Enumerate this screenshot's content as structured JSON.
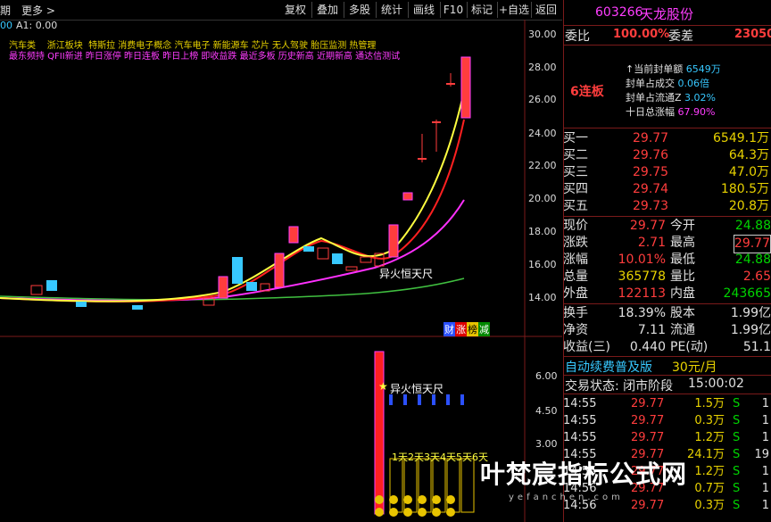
{
  "toolbar": {
    "left_cut": "期",
    "more": "更多 >",
    "buttons": [
      "复权",
      "叠加",
      "多股",
      "统计",
      "画线",
      "F10",
      "标记",
      "+自选",
      "返回"
    ]
  },
  "chart_header": {
    "indicator": "A1: 0.00",
    "concepts_line1": [
      "汽车类",
      "浙江板块",
      "特斯拉",
      "消费电子概念",
      "汽车电子",
      "新能源车",
      "芯片",
      "无人驾驶",
      "胎压监测",
      "热管理"
    ],
    "concepts_line2": "最东频持 QFII新进 昨日涨停 昨日连板 昨日上榜 即收益跌 最近多板 历史新高 近期新高 通达信测试"
  },
  "price_axis": [
    "30.00",
    "28.00",
    "26.00",
    "24.00",
    "22.00",
    "20.00",
    "18.00",
    "16.00",
    "14.00"
  ],
  "annotations": {
    "main": "异火恒天尺",
    "badge1": "财",
    "badge2": "涨",
    "badge3": "榜",
    "badge4": "减",
    "sub": "异火恒天尺",
    "days": [
      "1天",
      "2天",
      "3天",
      "4天",
      "5天",
      "6天"
    ]
  },
  "sub_axis": [
    "6.00",
    "4.50",
    "3.00"
  ],
  "stock": {
    "code": "603266",
    "name": "天龙股份",
    "weibi_label": "委比",
    "weibi": "100.00%",
    "weicha_label": "委差",
    "weicha": "23050",
    "board": "6连板",
    "seal_stats": [
      {
        "label": "当前封单额",
        "value": "6549万"
      },
      {
        "label": "封单占成交",
        "value": "0.06倍"
      },
      {
        "label": "封单占流通Z",
        "value": "3.02%"
      },
      {
        "label": "十日总涨幅",
        "value": "67.90%"
      }
    ]
  },
  "bids": [
    {
      "label": "买一",
      "price": "29.77",
      "vol": "6549.1万"
    },
    {
      "label": "买二",
      "price": "29.76",
      "vol": "64.3万"
    },
    {
      "label": "买三",
      "price": "29.75",
      "vol": "47.0万"
    },
    {
      "label": "买四",
      "price": "29.74",
      "vol": "180.5万"
    },
    {
      "label": "买五",
      "price": "29.73",
      "vol": "20.8万"
    }
  ],
  "quote": [
    {
      "l1": "现价",
      "v1": "29.77",
      "l2": "今开",
      "v2": "24.88"
    },
    {
      "l1": "涨跌",
      "v1": "2.71",
      "l2": "最高",
      "v2": "29.77"
    },
    {
      "l1": "涨幅",
      "v1": "10.01%",
      "l2": "最低",
      "v2": "24.88"
    },
    {
      "l1": "总量",
      "v1": "365778",
      "l2": "量比",
      "v2": "2.65"
    },
    {
      "l1": "外盘",
      "v1": "122113",
      "l2": "内盘",
      "v2": "243665"
    }
  ],
  "fund": [
    {
      "l1": "换手",
      "v1": "18.39%",
      "l2": "股本",
      "v2": "1.99亿"
    },
    {
      "l1": "净资",
      "v1": "7.11",
      "l2": "流通",
      "v2": "1.99亿"
    },
    {
      "l1": "收益(三)",
      "v1": "0.440",
      "l2": "PE(动)",
      "v2": "51.1"
    }
  ],
  "promo": {
    "text": "自动续费普及版",
    "price": "30元/月"
  },
  "status": {
    "label": "交易状态: 闭市阶段",
    "time": "15:00:02"
  },
  "trades": [
    {
      "t": "14:55",
      "p": "29.77",
      "v": "1.5万",
      "s": "S",
      "n": "1"
    },
    {
      "t": "14:55",
      "p": "29.77",
      "v": "0.3万",
      "s": "S",
      "n": "1"
    },
    {
      "t": "14:55",
      "p": "29.77",
      "v": "1.2万",
      "s": "S",
      "n": "1"
    },
    {
      "t": "14:55",
      "p": "29.77",
      "v": "24.1万",
      "s": "S",
      "n": "19"
    },
    {
      "t": "14:55",
      "p": "29.77",
      "v": "1.2万",
      "s": "S",
      "n": "1"
    },
    {
      "t": "14:56",
      "p": "29.77",
      "v": "0.7万",
      "s": "S",
      "n": "1"
    },
    {
      "t": "14:56",
      "p": "29.77",
      "v": "0.3万",
      "s": "S",
      "n": "1"
    }
  ],
  "watermark": {
    "text": "叶梵宸指标公式网",
    "url": "yefanchen.com"
  },
  "colors": {
    "up": "#ff3d3d",
    "down": "#00d400",
    "ma5": "#ffff40",
    "ma10": "#ff2020",
    "ma20": "#ff30ff",
    "ma60": "#40c040"
  }
}
